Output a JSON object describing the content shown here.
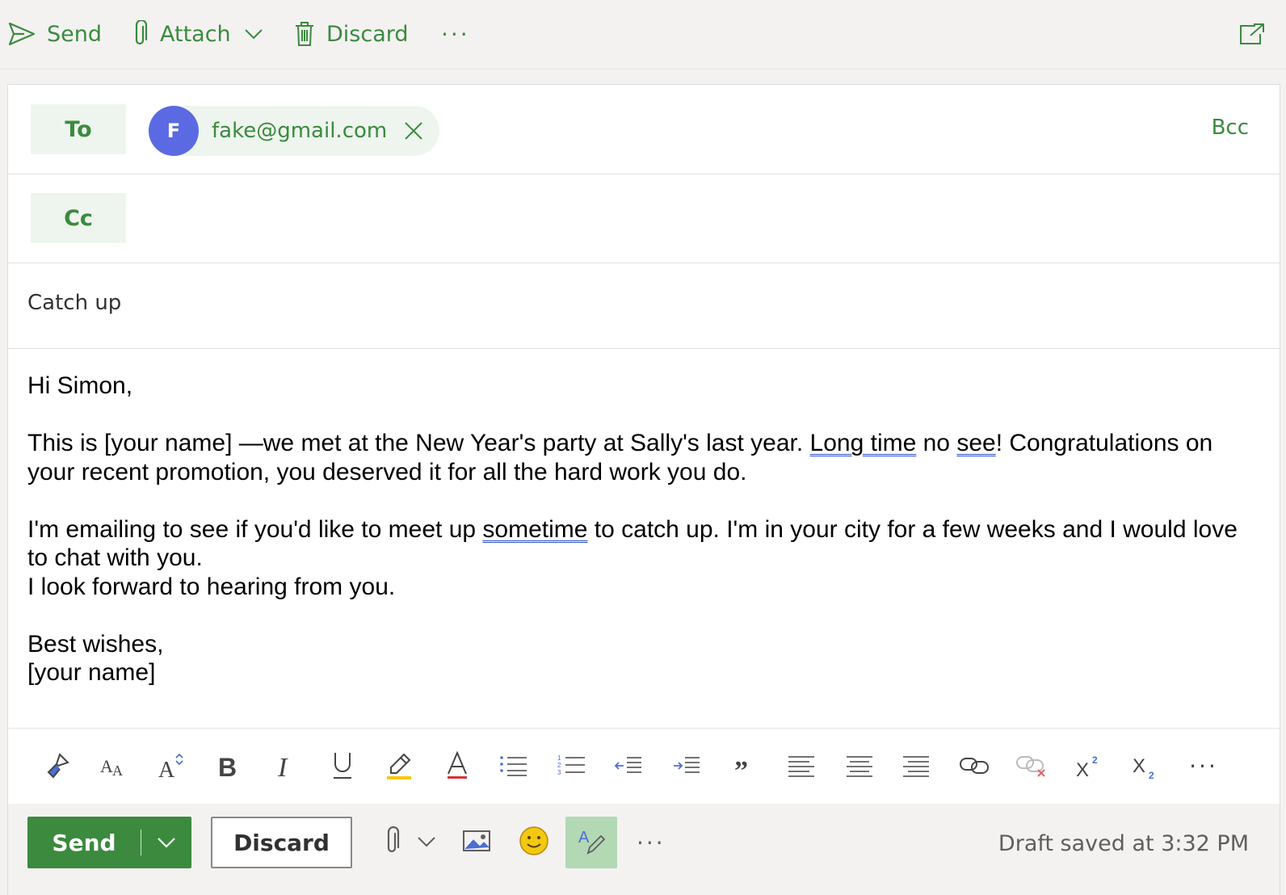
{
  "toolbar": {
    "send_label": "Send",
    "attach_label": "Attach",
    "discard_label": "Discard",
    "more_label": "···"
  },
  "recipients": {
    "to_label": "To",
    "cc_label": "Cc",
    "bcc_label": "Bcc",
    "to_chips": [
      {
        "initial": "F",
        "email": "fake@gmail.com"
      }
    ]
  },
  "subject": "Catch up",
  "body": {
    "greeting": "Hi Simon,",
    "p1": {
      "a": "This is [your name] —we met at the New Year's party at Sally's last year. ",
      "sq1": "Long time",
      "b": " no ",
      "sq2": "see",
      "c": "! Congratulations on your recent promotion, you deserved it for all the hard work you do."
    },
    "p2": {
      "a": "I'm emailing to see if you'd like to meet up ",
      "sq1": "sometime",
      "b": " to catch up. I'm in your city for a few weeks and I would love to chat with you."
    },
    "p3": "I look forward to hearing from you.",
    "signoff": "Best wishes,",
    "signature": "[your name]"
  },
  "format_toolbar": [
    "format-painter-icon",
    "font-size-icon",
    "grow-font-icon",
    "bold-icon",
    "italic-icon",
    "underline-icon",
    "highlight-icon",
    "font-color-icon",
    "bullets-icon",
    "numbering-icon",
    "decrease-indent-icon",
    "increase-indent-icon",
    "quote-icon",
    "align-left-icon",
    "align-center-icon",
    "align-right-icon",
    "link-icon",
    "remove-link-icon",
    "superscript-icon",
    "subscript-icon",
    "more-options-icon"
  ],
  "actions": {
    "send_label": "Send",
    "discard_label": "Discard",
    "more_label": "···",
    "draft_status": "Draft saved at 3:32 PM"
  },
  "colors": {
    "accent": "#3b8a3e",
    "avatar": "#5b6ae3",
    "editor_active": "#b3d8b4",
    "spell_underline": "#2b50c8"
  }
}
